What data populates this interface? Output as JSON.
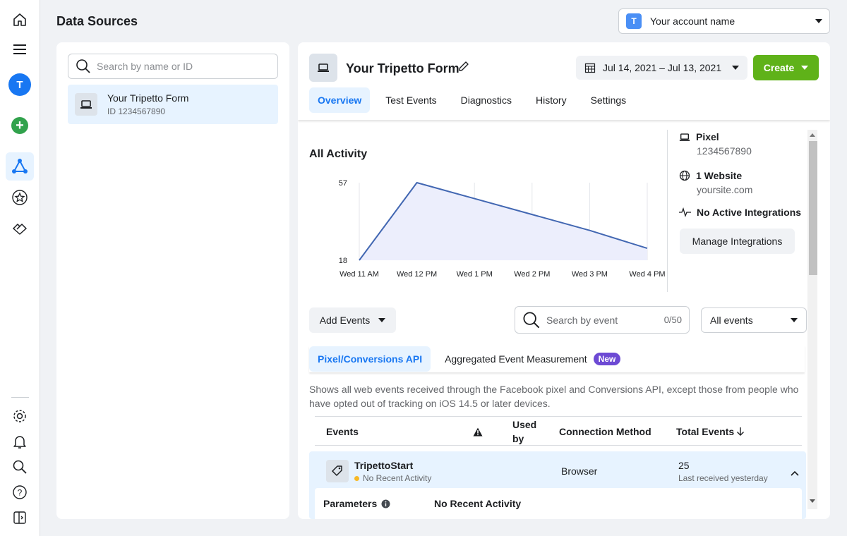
{
  "header": {
    "title": "Data Sources",
    "account_initial": "T",
    "account_name": "Your account name"
  },
  "rail": {
    "avatar_initial": "T"
  },
  "left": {
    "search_placeholder": "Search by name or ID",
    "source": {
      "name": "Your Tripetto Form",
      "id": "ID 1234567890"
    }
  },
  "detail": {
    "title": "Your Tripetto Form",
    "date_range": "Jul 14, 2021 – Jul 13, 2021",
    "create_label": "Create",
    "tabs": [
      "Overview",
      "Test Events",
      "Diagnostics",
      "History",
      "Settings"
    ],
    "active_tab": "Overview"
  },
  "activity": {
    "title": "All Activity"
  },
  "chart_data": {
    "type": "area",
    "title": "All Activity",
    "x": [
      "Wed 11 AM",
      "Wed 12 PM",
      "Wed 1 PM",
      "Wed 2 PM",
      "Wed 3 PM",
      "Wed 4 PM"
    ],
    "y_ticks": [
      18,
      57
    ],
    "ylim": [
      18,
      57
    ],
    "series": [
      {
        "values": [
          18,
          57,
          49,
          41,
          33,
          24
        ]
      }
    ],
    "colors": {
      "line": "#4267b2",
      "fill": "#eceefc"
    },
    "grid": "vertical"
  },
  "info": {
    "pixel_title": "Pixel",
    "pixel_id": "1234567890",
    "website_title": "1 Website",
    "website_url": "yoursite.com",
    "integrations_title": "No Active Integrations",
    "manage_label": "Manage Integrations"
  },
  "events_bar": {
    "add_label": "Add Events",
    "search_placeholder": "Search by event",
    "search_count": "0/50",
    "filter_value": "All events"
  },
  "subtabs": {
    "tab1": "Pixel/Conversions API",
    "tab2": "Aggregated Event Measurement",
    "badge": "New"
  },
  "description": "Shows all web events received through the Facebook pixel and Conversions API, except those from people who have opted out of tracking on iOS 14.5 or later devices.",
  "table": {
    "headers": {
      "events": "Events",
      "used_by_1": "Used",
      "used_by_2": "by",
      "method": "Connection Method",
      "total": "Total Events"
    },
    "row": {
      "name": "TripettoStart",
      "status": "No Recent Activity",
      "method": "Browser",
      "total": "25",
      "last": "Last received yesterday",
      "params_label": "Parameters",
      "params_value": "No Recent Activity"
    }
  },
  "colors": {
    "accent": "#1877f2",
    "create": "#5fb219",
    "badge": "#6d4ad4",
    "status_dot": "#f7b928"
  }
}
